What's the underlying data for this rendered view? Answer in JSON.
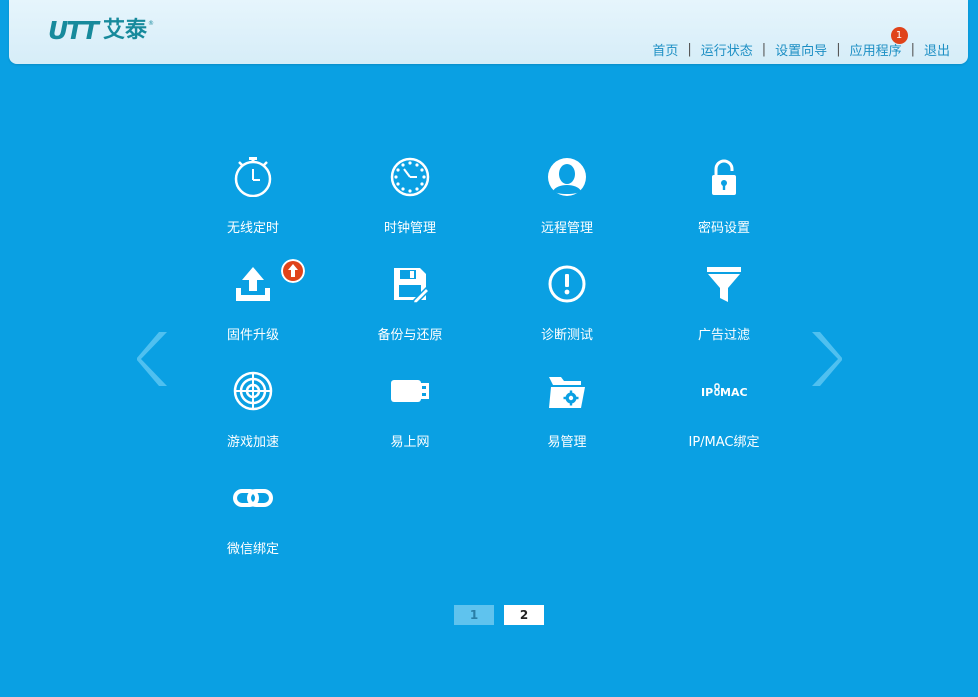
{
  "header": {
    "logo_mark": "UTT",
    "logo_text": "艾泰",
    "logo_reg": "®",
    "nav": [
      {
        "label": "首页"
      },
      {
        "label": "运行状态"
      },
      {
        "label": "设置向导"
      },
      {
        "label": "应用程序",
        "badge": "1"
      },
      {
        "label": "退出"
      }
    ],
    "separator": "|"
  },
  "apps": [
    {
      "label": "无线定时",
      "icon": "stopwatch-icon"
    },
    {
      "label": "时钟管理",
      "icon": "clock-icon"
    },
    {
      "label": "远程管理",
      "icon": "user-icon"
    },
    {
      "label": "密码设置",
      "icon": "lock-icon"
    },
    {
      "label": "固件升级",
      "icon": "upload-icon",
      "badge": "upgrade-arrow-icon"
    },
    {
      "label": "备份与还原",
      "icon": "floppy-disk-icon"
    },
    {
      "label": "诊断测试",
      "icon": "exclamation-circle-icon"
    },
    {
      "label": "广告过滤",
      "icon": "funnel-icon"
    },
    {
      "label": "游戏加速",
      "icon": "crosshair-icon"
    },
    {
      "label": "易上网",
      "icon": "usb-plug-icon"
    },
    {
      "label": "易管理",
      "icon": "folder-gear-icon"
    },
    {
      "label": "IP/MAC绑定",
      "icon": "ip-mac-icon",
      "icon_text_left": "IP",
      "icon_text_right": "MAC"
    },
    {
      "label": "微信绑定",
      "icon": "chain-link-icon"
    }
  ],
  "pagination": {
    "pages": [
      "1",
      "2"
    ],
    "current": "2"
  },
  "colors": {
    "background": "#0aa0e3",
    "header": "#e6f5fc",
    "nav_link": "#1d8fc4",
    "badge": "#e0431a"
  }
}
